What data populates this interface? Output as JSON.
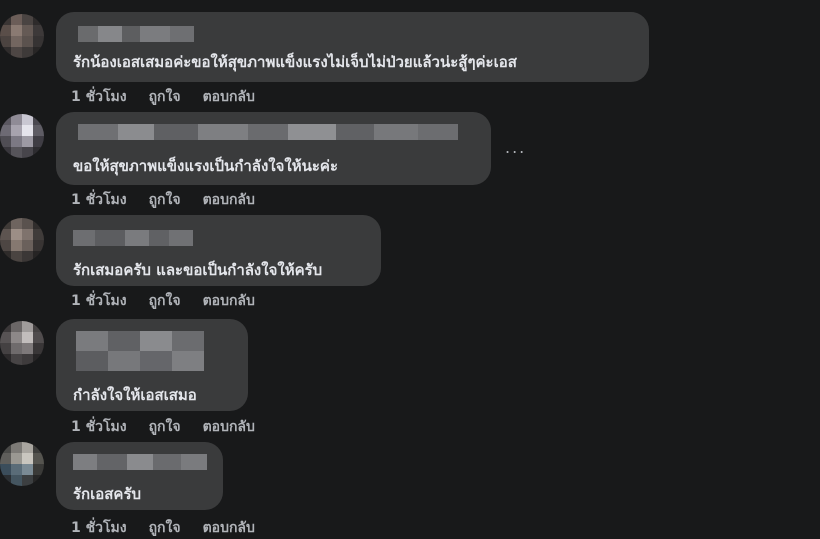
{
  "comments": [
    {
      "text": "รักน้องเอสเสมอค่ะขอให้สุขภาพแข็งแรงไม่เจ็บไม่ป่วยแล้วน่ะสู้ๆค่ะเอส",
      "time": "1 ชั่วโมง",
      "like": "ถูกใจ",
      "reply": "ตอบกลับ"
    },
    {
      "text": "ขอให้สุขภาพแข็งแรงเป็นกำลังใจให้นะค่ะ",
      "time": "1 ชั่วโมง",
      "like": "ถูกใจ",
      "reply": "ตอบกลับ",
      "more": "..."
    },
    {
      "text": "รักเสมอครับ และขอเป็นกำลังใจให้ครับ",
      "time": "1 ชั่วโมง",
      "like": "ถูกใจ",
      "reply": "ตอบกลับ"
    },
    {
      "text": "กำลังใจให้เอสเสมอ",
      "time": "1 ชั่วโมง",
      "like": "ถูกใจ",
      "reply": "ตอบกลับ"
    },
    {
      "text": "รักเอสครับ",
      "time": "1 ชั่วโมง",
      "like": "ถูกใจ",
      "reply": "ตอบกลับ"
    }
  ],
  "colors": {
    "background": "#18191a",
    "bubble": "#3a3b3c",
    "text": "#e4e6eb",
    "secondary_text": "#b0b3b8"
  },
  "icons": {
    "more": "horizontal-ellipsis-icon"
  }
}
